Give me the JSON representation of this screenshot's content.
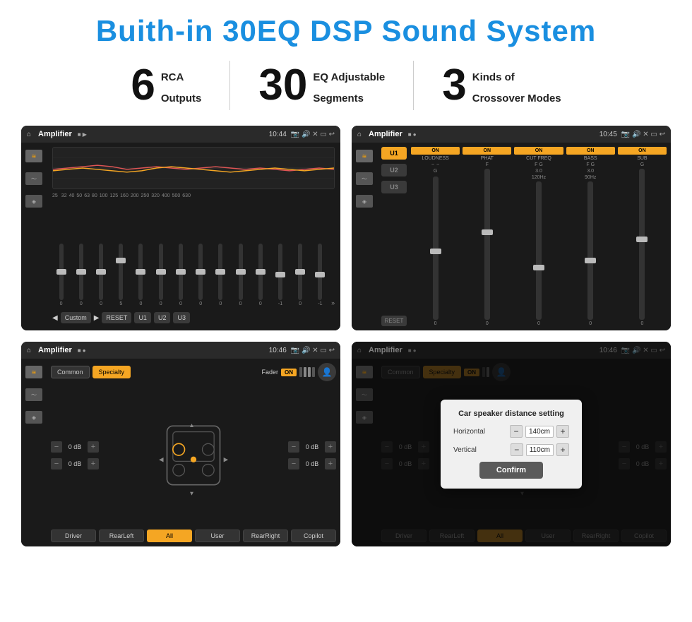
{
  "header": {
    "title": "Buith-in 30EQ DSP Sound System"
  },
  "stats": [
    {
      "number": "6",
      "line1": "RCA",
      "line2": "Outputs"
    },
    {
      "number": "30",
      "line1": "EQ Adjustable",
      "line2": "Segments"
    },
    {
      "number": "3",
      "line1": "Kinds of",
      "line2": "Crossover Modes"
    }
  ],
  "screens": {
    "screen1": {
      "topbar": {
        "title": "Amplifier",
        "time": "10:44"
      },
      "eq_labels": [
        "25",
        "32",
        "40",
        "50",
        "63",
        "80",
        "100",
        "125",
        "160",
        "200",
        "250",
        "320",
        "400",
        "500",
        "630"
      ],
      "eq_values": [
        "0",
        "0",
        "0",
        "5",
        "0",
        "0",
        "0",
        "0",
        "0",
        "0",
        "0",
        "-1",
        "0",
        "-1"
      ],
      "eq_preset": "Custom",
      "buttons": [
        "RESET",
        "U1",
        "U2",
        "U3"
      ]
    },
    "screen2": {
      "topbar": {
        "title": "Amplifier",
        "time": "10:45"
      },
      "presets": [
        "U1",
        "U2",
        "U3"
      ],
      "channels": [
        "LOUDNESS",
        "PHAT",
        "CUT FREQ",
        "BASS",
        "SUB"
      ],
      "on_labels": [
        "ON",
        "ON",
        "ON",
        "ON",
        "ON"
      ],
      "reset": "RESET"
    },
    "screen3": {
      "topbar": {
        "title": "Amplifier",
        "time": "10:46"
      },
      "tabs": [
        "Common",
        "Specialty"
      ],
      "active_tab": "Specialty",
      "fader_label": "Fader",
      "on_label": "ON",
      "vol_rows": [
        {
          "value": "0 dB"
        },
        {
          "value": "0 dB"
        },
        {
          "value": "0 dB"
        },
        {
          "value": "0 dB"
        }
      ],
      "bottom_btns": [
        "Driver",
        "RearLeft",
        "All",
        "User",
        "RearRight",
        "Copilot"
      ]
    },
    "screen4": {
      "topbar": {
        "title": "Amplifier",
        "time": "10:46"
      },
      "tabs": [
        "Common",
        "Specialty"
      ],
      "dialog": {
        "title": "Car speaker distance setting",
        "rows": [
          {
            "label": "Horizontal",
            "value": "140cm"
          },
          {
            "label": "Vertical",
            "value": "110cm"
          }
        ],
        "confirm_btn": "Confirm"
      },
      "vol_rows": [
        {
          "value": "0 dB"
        },
        {
          "value": "0 dB"
        }
      ],
      "bottom_btns": [
        "Driver",
        "RearLeft",
        "All",
        "User",
        "RearRight",
        "Copilot"
      ]
    }
  },
  "icons": {
    "home": "⌂",
    "back": "↩",
    "location": "📍",
    "camera": "📷",
    "volume": "🔊",
    "close": "✕",
    "minimize": "─",
    "eq_icon": "≋",
    "wave_icon": "〜",
    "speaker_icon": "◈"
  }
}
